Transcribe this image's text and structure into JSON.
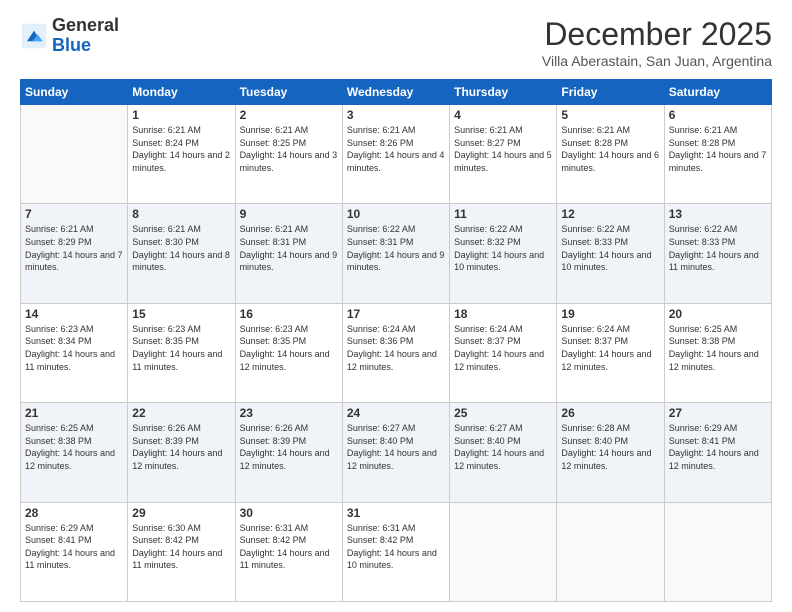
{
  "logo": {
    "line1": "General",
    "line2": "Blue"
  },
  "header": {
    "month": "December 2025",
    "subtitle": "Villa Aberastain, San Juan, Argentina"
  },
  "weekdays": [
    "Sunday",
    "Monday",
    "Tuesday",
    "Wednesday",
    "Thursday",
    "Friday",
    "Saturday"
  ],
  "weeks": [
    [
      {
        "day": "",
        "sunrise": "",
        "sunset": "",
        "daylight": ""
      },
      {
        "day": "1",
        "sunrise": "Sunrise: 6:21 AM",
        "sunset": "Sunset: 8:24 PM",
        "daylight": "Daylight: 14 hours and 2 minutes."
      },
      {
        "day": "2",
        "sunrise": "Sunrise: 6:21 AM",
        "sunset": "Sunset: 8:25 PM",
        "daylight": "Daylight: 14 hours and 3 minutes."
      },
      {
        "day": "3",
        "sunrise": "Sunrise: 6:21 AM",
        "sunset": "Sunset: 8:26 PM",
        "daylight": "Daylight: 14 hours and 4 minutes."
      },
      {
        "day": "4",
        "sunrise": "Sunrise: 6:21 AM",
        "sunset": "Sunset: 8:27 PM",
        "daylight": "Daylight: 14 hours and 5 minutes."
      },
      {
        "day": "5",
        "sunrise": "Sunrise: 6:21 AM",
        "sunset": "Sunset: 8:28 PM",
        "daylight": "Daylight: 14 hours and 6 minutes."
      },
      {
        "day": "6",
        "sunrise": "Sunrise: 6:21 AM",
        "sunset": "Sunset: 8:28 PM",
        "daylight": "Daylight: 14 hours and 7 minutes."
      }
    ],
    [
      {
        "day": "7",
        "sunrise": "Sunrise: 6:21 AM",
        "sunset": "Sunset: 8:29 PM",
        "daylight": "Daylight: 14 hours and 7 minutes."
      },
      {
        "day": "8",
        "sunrise": "Sunrise: 6:21 AM",
        "sunset": "Sunset: 8:30 PM",
        "daylight": "Daylight: 14 hours and 8 minutes."
      },
      {
        "day": "9",
        "sunrise": "Sunrise: 6:21 AM",
        "sunset": "Sunset: 8:31 PM",
        "daylight": "Daylight: 14 hours and 9 minutes."
      },
      {
        "day": "10",
        "sunrise": "Sunrise: 6:22 AM",
        "sunset": "Sunset: 8:31 PM",
        "daylight": "Daylight: 14 hours and 9 minutes."
      },
      {
        "day": "11",
        "sunrise": "Sunrise: 6:22 AM",
        "sunset": "Sunset: 8:32 PM",
        "daylight": "Daylight: 14 hours and 10 minutes."
      },
      {
        "day": "12",
        "sunrise": "Sunrise: 6:22 AM",
        "sunset": "Sunset: 8:33 PM",
        "daylight": "Daylight: 14 hours and 10 minutes."
      },
      {
        "day": "13",
        "sunrise": "Sunrise: 6:22 AM",
        "sunset": "Sunset: 8:33 PM",
        "daylight": "Daylight: 14 hours and 11 minutes."
      }
    ],
    [
      {
        "day": "14",
        "sunrise": "Sunrise: 6:23 AM",
        "sunset": "Sunset: 8:34 PM",
        "daylight": "Daylight: 14 hours and 11 minutes."
      },
      {
        "day": "15",
        "sunrise": "Sunrise: 6:23 AM",
        "sunset": "Sunset: 8:35 PM",
        "daylight": "Daylight: 14 hours and 11 minutes."
      },
      {
        "day": "16",
        "sunrise": "Sunrise: 6:23 AM",
        "sunset": "Sunset: 8:35 PM",
        "daylight": "Daylight: 14 hours and 12 minutes."
      },
      {
        "day": "17",
        "sunrise": "Sunrise: 6:24 AM",
        "sunset": "Sunset: 8:36 PM",
        "daylight": "Daylight: 14 hours and 12 minutes."
      },
      {
        "day": "18",
        "sunrise": "Sunrise: 6:24 AM",
        "sunset": "Sunset: 8:37 PM",
        "daylight": "Daylight: 14 hours and 12 minutes."
      },
      {
        "day": "19",
        "sunrise": "Sunrise: 6:24 AM",
        "sunset": "Sunset: 8:37 PM",
        "daylight": "Daylight: 14 hours and 12 minutes."
      },
      {
        "day": "20",
        "sunrise": "Sunrise: 6:25 AM",
        "sunset": "Sunset: 8:38 PM",
        "daylight": "Daylight: 14 hours and 12 minutes."
      }
    ],
    [
      {
        "day": "21",
        "sunrise": "Sunrise: 6:25 AM",
        "sunset": "Sunset: 8:38 PM",
        "daylight": "Daylight: 14 hours and 12 minutes."
      },
      {
        "day": "22",
        "sunrise": "Sunrise: 6:26 AM",
        "sunset": "Sunset: 8:39 PM",
        "daylight": "Daylight: 14 hours and 12 minutes."
      },
      {
        "day": "23",
        "sunrise": "Sunrise: 6:26 AM",
        "sunset": "Sunset: 8:39 PM",
        "daylight": "Daylight: 14 hours and 12 minutes."
      },
      {
        "day": "24",
        "sunrise": "Sunrise: 6:27 AM",
        "sunset": "Sunset: 8:40 PM",
        "daylight": "Daylight: 14 hours and 12 minutes."
      },
      {
        "day": "25",
        "sunrise": "Sunrise: 6:27 AM",
        "sunset": "Sunset: 8:40 PM",
        "daylight": "Daylight: 14 hours and 12 minutes."
      },
      {
        "day": "26",
        "sunrise": "Sunrise: 6:28 AM",
        "sunset": "Sunset: 8:40 PM",
        "daylight": "Daylight: 14 hours and 12 minutes."
      },
      {
        "day": "27",
        "sunrise": "Sunrise: 6:29 AM",
        "sunset": "Sunset: 8:41 PM",
        "daylight": "Daylight: 14 hours and 12 minutes."
      }
    ],
    [
      {
        "day": "28",
        "sunrise": "Sunrise: 6:29 AM",
        "sunset": "Sunset: 8:41 PM",
        "daylight": "Daylight: 14 hours and 11 minutes."
      },
      {
        "day": "29",
        "sunrise": "Sunrise: 6:30 AM",
        "sunset": "Sunset: 8:42 PM",
        "daylight": "Daylight: 14 hours and 11 minutes."
      },
      {
        "day": "30",
        "sunrise": "Sunrise: 6:31 AM",
        "sunset": "Sunset: 8:42 PM",
        "daylight": "Daylight: 14 hours and 11 minutes."
      },
      {
        "day": "31",
        "sunrise": "Sunrise: 6:31 AM",
        "sunset": "Sunset: 8:42 PM",
        "daylight": "Daylight: 14 hours and 10 minutes."
      },
      {
        "day": "",
        "sunrise": "",
        "sunset": "",
        "daylight": ""
      },
      {
        "day": "",
        "sunrise": "",
        "sunset": "",
        "daylight": ""
      },
      {
        "day": "",
        "sunrise": "",
        "sunset": "",
        "daylight": ""
      }
    ]
  ]
}
